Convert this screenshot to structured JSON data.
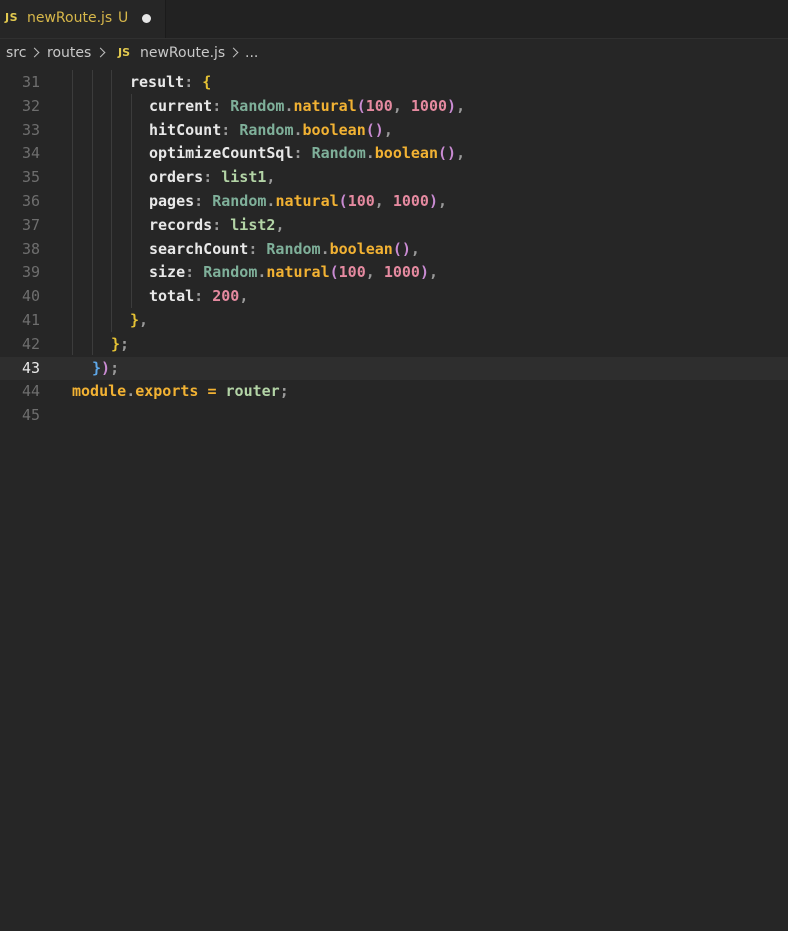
{
  "tab": {
    "icon": "JS",
    "filename": "newRoute.js",
    "status": "U"
  },
  "breadcrumb": {
    "items": [
      "src",
      "routes",
      "newRoute.js",
      "..."
    ],
    "js_icon": "JS"
  },
  "editor": {
    "lines": [
      {
        "num": "31",
        "text": "result: {"
      },
      {
        "num": "32",
        "text": "current: Random.natural(100, 1000),"
      },
      {
        "num": "33",
        "text": "hitCount: Random.boolean(),"
      },
      {
        "num": "34",
        "text": "optimizeCountSql: Random.boolean(),"
      },
      {
        "num": "35",
        "text": "orders: list1,"
      },
      {
        "num": "36",
        "text": "pages: Random.natural(100, 1000),"
      },
      {
        "num": "37",
        "text": "records: list2,"
      },
      {
        "num": "38",
        "text": "searchCount: Random.boolean(),"
      },
      {
        "num": "39",
        "text": "size: Random.natural(100, 1000),"
      },
      {
        "num": "40",
        "text": "total: 200,"
      },
      {
        "num": "41",
        "text": "},"
      },
      {
        "num": "42",
        "text": "};"
      },
      {
        "num": "43",
        "text": "});"
      },
      {
        "num": "44",
        "text": "module.exports = router;"
      },
      {
        "num": "45",
        "text": ""
      }
    ],
    "current_line": "43"
  },
  "colors": {
    "background": "#262626",
    "tab_label": "#d7b74a",
    "function": "#f2b233",
    "number": "#e58aa0",
    "class": "#7fb09a"
  }
}
